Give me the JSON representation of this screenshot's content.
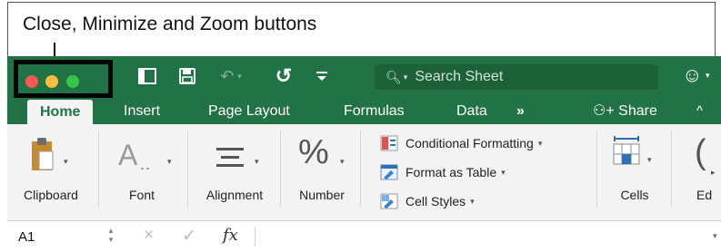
{
  "caption": "Close, Minimize and Zoom buttons",
  "colors": {
    "accent": "#217346",
    "close": "#fc5753",
    "minimize": "#fdbc40",
    "zoom": "#33c748"
  },
  "toolbar": {
    "icons": [
      "sidebar-icon",
      "save-icon",
      "undo-icon",
      "redo-icon",
      "customize-toolbar-icon"
    ],
    "search_placeholder": "Search Sheet",
    "account_icon": "smiley-icon"
  },
  "tabs": {
    "items": [
      "Home",
      "Insert",
      "Page Layout",
      "Formulas",
      "Data"
    ],
    "more": "»",
    "share": "Share",
    "collapse": "^"
  },
  "ribbon": {
    "groups": [
      "Clipboard",
      "Font",
      "Alignment",
      "Number",
      "Cells",
      "Ed"
    ],
    "styles": [
      "Conditional Formatting",
      "Format as Table",
      "Cell Styles"
    ],
    "font_icon_text": "A",
    "number_icon_text": "%"
  },
  "formula_bar": {
    "name_box": "A1",
    "cancel_icon": "×",
    "enter_icon": "✓",
    "function_label": "fx"
  }
}
